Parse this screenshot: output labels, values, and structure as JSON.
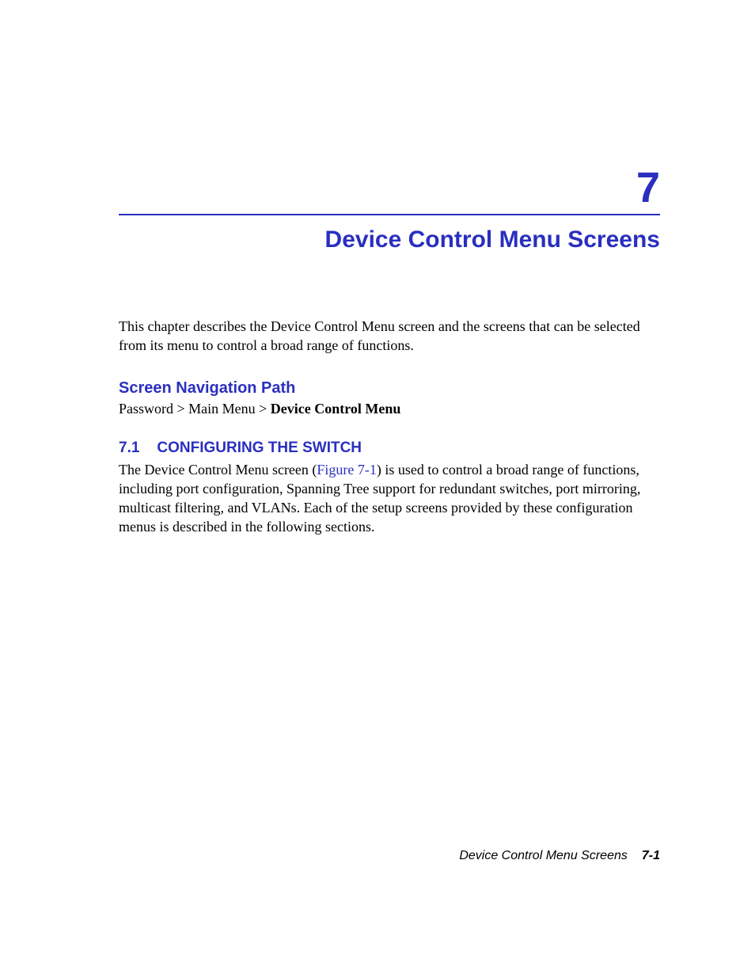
{
  "chapter": {
    "number": "7",
    "title": "Device Control Menu Screens",
    "intro": "This chapter describes the Device Control Menu screen and the screens that can be selected from its menu to control a broad range of functions."
  },
  "navHeading": "Screen Navigation Path",
  "navPath": {
    "prefix": "Password > Main Menu > ",
    "boldSuffix": "Device Control Menu"
  },
  "section": {
    "number": "7.1",
    "title": "CONFIGURING THE SWITCH",
    "bodyPrefix": "The Device Control Menu screen (",
    "figRef": "Figure 7-1",
    "bodySuffix": ") is used to control a broad range of functions, including port configuration, Spanning Tree support for redundant switches, port mirroring, multicast filtering, and VLANs. Each of the setup screens provided by these configuration menus is described in the following sections."
  },
  "footer": {
    "title": "Device Control Menu Screens",
    "page": "7-1"
  }
}
